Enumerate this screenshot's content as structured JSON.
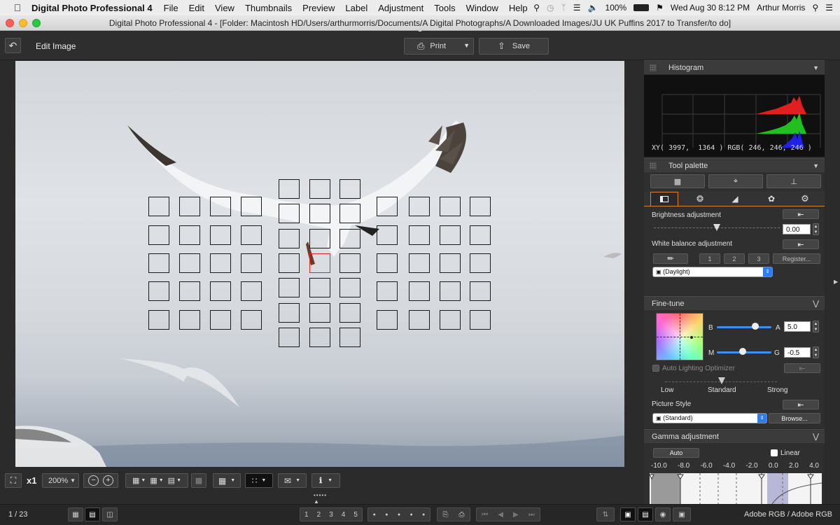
{
  "menubar": {
    "app_name": "Digital Photo Professional 4",
    "items": [
      "File",
      "Edit",
      "View",
      "Thumbnails",
      "Preview",
      "Label",
      "Adjustment",
      "Tools",
      "Window",
      "Help"
    ],
    "battery": "100%",
    "clock": "Wed Aug 30  8:12 PM",
    "user": "Arthur Morris"
  },
  "window": {
    "title": "Digital Photo Professional 4 - [Folder: Macintosh HD/Users/arthurmorris/Documents/A Digital Photographs/A Downloaded Images/JU UK Puffins 2017 to Transfer/to do]"
  },
  "toolbar": {
    "mode_label": "Edit Image",
    "print_label": "Print",
    "save_label": "Save"
  },
  "histogram": {
    "title": "Histogram",
    "readout": "XY( 3997,  1364 ) RGB( 246, 246, 246 )"
  },
  "tool_palette": {
    "title": "Tool palette",
    "brightness_label": "Brightness adjustment",
    "brightness_value": "0.00",
    "brightness_level": 0.5,
    "wb_label": "White balance adjustment",
    "wb_presets": [
      "1",
      "2",
      "3"
    ],
    "register_label": "Register...",
    "wb_selected": "(Daylight)"
  },
  "fine_tune": {
    "title": "Fine-tune",
    "b_label": "B",
    "a_label": "A",
    "a_value": "5.0",
    "m_label": "M",
    "g_label": "G",
    "g_value": "-0.5",
    "alo_label": "Auto Lighting Optimizer",
    "alo_levels": [
      "Low",
      "Standard",
      "Strong"
    ],
    "picture_style_label": "Picture Style",
    "picture_style_value": "(Standard)",
    "browse_label": "Browse..."
  },
  "gamma": {
    "title": "Gamma adjustment",
    "auto_label": "Auto",
    "linear_label": "Linear",
    "scale": [
      "-10.0",
      "-8.0",
      "-6.0",
      "-4.0",
      "-2.0",
      "0.0",
      "2.0",
      "4.0"
    ]
  },
  "viewbar": {
    "zoom_x1": "x1",
    "zoom_level": "200%"
  },
  "status": {
    "page_indicator": "1 / 23",
    "ratings": [
      "1",
      "2",
      "3",
      "4",
      "5"
    ],
    "color_space": "Adobe RGB / Adobe RGB"
  },
  "colors": {
    "window_bg": "#2b2b2b",
    "af_point": "#1a1a1a",
    "af_selected": "#e32424",
    "accent_blue": "#2f7bf0",
    "tab_active": "#d9822b"
  }
}
